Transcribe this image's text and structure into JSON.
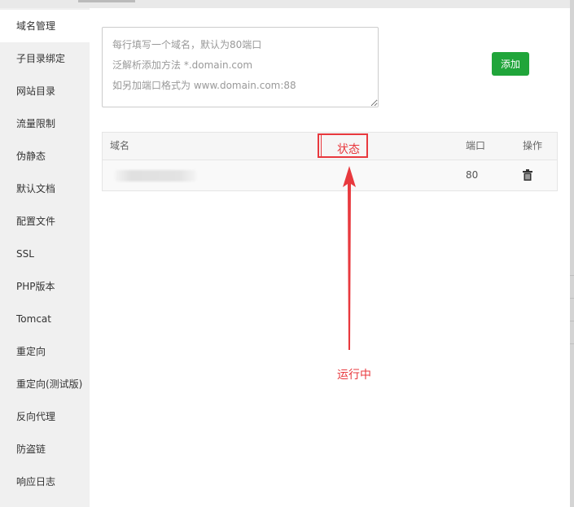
{
  "sidebar": {
    "items": [
      {
        "label": "域名管理",
        "active": true
      },
      {
        "label": "子目录绑定"
      },
      {
        "label": "网站目录"
      },
      {
        "label": "流量限制"
      },
      {
        "label": "伪静态"
      },
      {
        "label": "默认文档"
      },
      {
        "label": "配置文件"
      },
      {
        "label": "SSL"
      },
      {
        "label": "PHP版本"
      },
      {
        "label": "Tomcat"
      },
      {
        "label": "重定向"
      },
      {
        "label": "重定向(测试版)"
      },
      {
        "label": "反向代理"
      },
      {
        "label": "防盗链"
      },
      {
        "label": "响应日志"
      }
    ]
  },
  "domain_form": {
    "placeholder": "每行填写一个域名，默认为80端口\n泛解析添加方法 *.domain.com\n如另加端口格式为 www.domain.com:88",
    "value": "",
    "add_label": "添加"
  },
  "table": {
    "headers": {
      "domain": "域名",
      "status": "状态",
      "port": "端口",
      "action": "操作"
    },
    "rows": [
      {
        "domain": "",
        "port": "80",
        "action_icon": "trash-icon"
      }
    ]
  },
  "annotation": {
    "label": "状态",
    "caption": "运行中",
    "color": "#e8393e"
  },
  "colors": {
    "accent": "#20a53a",
    "sidebar_bg": "#f0f0f0"
  }
}
